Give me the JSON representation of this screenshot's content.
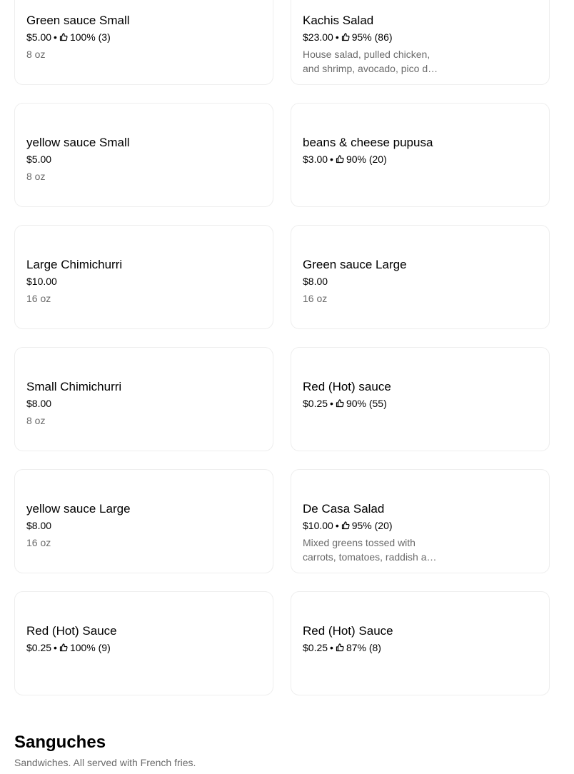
{
  "items": [
    {
      "name": "Green sauce Small",
      "price": "$5.00",
      "rating": "100% (3)",
      "desc": "8 oz"
    },
    {
      "name": "Kachis Salad",
      "price": "$23.00",
      "rating": "95% (86)",
      "desc": "House salad, pulled chicken, and shrimp, avocado, pico de gallo"
    },
    {
      "name": "yellow sauce Small",
      "price": "$5.00",
      "rating": "",
      "desc": "8 oz"
    },
    {
      "name": "beans & cheese pupusa",
      "price": "$3.00",
      "rating": "90% (20)",
      "desc": ""
    },
    {
      "name": "Large Chimichurri",
      "price": "$10.00",
      "rating": "",
      "desc": "16 oz"
    },
    {
      "name": "Green sauce Large",
      "price": "$8.00",
      "rating": "",
      "desc": "16 oz"
    },
    {
      "name": "Small Chimichurri",
      "price": "$8.00",
      "rating": "",
      "desc": "8 oz"
    },
    {
      "name": "Red (Hot) sauce",
      "price": "$0.25",
      "rating": "90% (55)",
      "desc": ""
    },
    {
      "name": "yellow sauce Large",
      "price": "$8.00",
      "rating": "",
      "desc": "16 oz"
    },
    {
      "name": "De Casa Salad",
      "price": "$10.00",
      "rating": "95% (20)",
      "desc": "Mixed greens tossed with carrots, tomatoes, raddish and cucumber"
    },
    {
      "name": "Red (Hot) Sauce",
      "price": "$0.25",
      "rating": "100% (9)",
      "desc": ""
    },
    {
      "name": "Red (Hot) Sauce",
      "price": "$0.25",
      "rating": "87% (8)",
      "desc": ""
    }
  ],
  "section": {
    "title": "Sanguches",
    "subtitle": "Sandwiches. All served with French fries."
  },
  "icons": {
    "rating": "thumbs-up-icon"
  },
  "colors": {
    "text": "#000000",
    "muted": "#6b6b6b",
    "border": "#eeeeee"
  }
}
